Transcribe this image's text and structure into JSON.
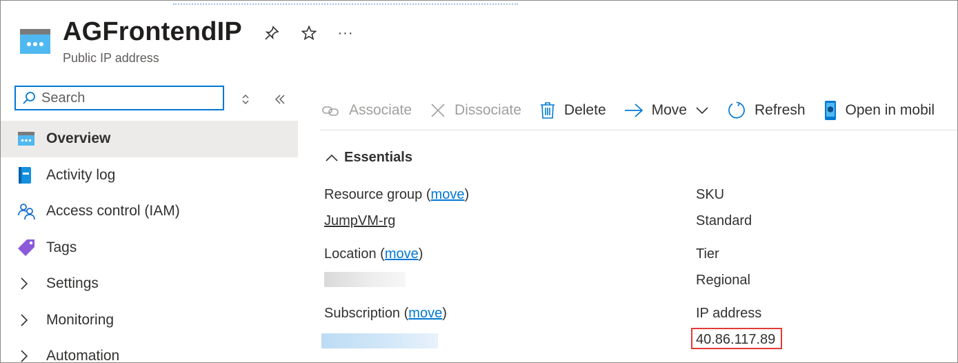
{
  "header": {
    "title": "AGFrontendIP",
    "subtitle": "Public IP address",
    "icons": [
      "public-ip-icon",
      "pin-icon",
      "star-icon",
      "more-icon"
    ],
    "more_label": "···"
  },
  "sidebar": {
    "search_placeholder": "Search",
    "items": [
      {
        "label": "Overview",
        "icon": "overview-icon",
        "active": true
      },
      {
        "label": "Activity log",
        "icon": "activity-log-icon"
      },
      {
        "label": "Access control (IAM)",
        "icon": "people-icon"
      },
      {
        "label": "Tags",
        "icon": "tag-icon"
      },
      {
        "label": "Settings",
        "icon": "chevron-right-icon"
      },
      {
        "label": "Monitoring",
        "icon": "chevron-right-icon"
      },
      {
        "label": "Automation",
        "icon": "chevron-right-icon"
      }
    ]
  },
  "toolbar": {
    "associate": "Associate",
    "dissociate": "Dissociate",
    "delete": "Delete",
    "move": "Move",
    "refresh": "Refresh",
    "open_mobile": "Open in mobil"
  },
  "essentials": {
    "heading": "Essentials",
    "resource_group_label": "Resource group",
    "move_link": "move",
    "resource_group_value": "JumpVM-rg",
    "location_label": "Location",
    "subscription_label": "Subscription",
    "sku_label": "SKU",
    "sku_value": "Standard",
    "tier_label": "Tier",
    "tier_value": "Regional",
    "ip_label": "IP address",
    "ip_value": "40.86.117.89"
  },
  "colors": {
    "accent": "#0078d4",
    "highlight_box": "#e53935",
    "active_nav_bg": "#edebe9"
  }
}
